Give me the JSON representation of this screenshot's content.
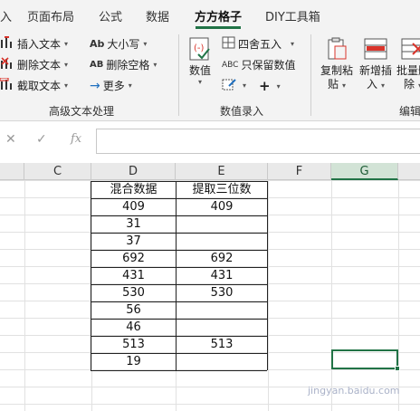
{
  "tabs": [
    {
      "label": "入"
    },
    {
      "label": "页面布局"
    },
    {
      "label": "公式"
    },
    {
      "label": "数据"
    },
    {
      "label": "方方格子"
    },
    {
      "label": "DIY工具箱"
    }
  ],
  "ribbon": {
    "text_group": {
      "insert_text": "插入文本",
      "delete_text": "删除文本",
      "cut_text": "截取文本",
      "case": "大小写",
      "delete_spaces": "删除空格",
      "more": "更多",
      "group_label": "高级文本处理"
    },
    "number_group": {
      "numeric_line1": "数值",
      "round": "四舍五入",
      "keep_numbers": "只保留数值",
      "group_label": "数值录入"
    },
    "edit_group": {
      "copy_paste_line1": "复制粘",
      "copy_paste_line2": "贴",
      "batch_insert_line1": "新增插",
      "batch_insert_line2": "入",
      "batch_delete_line1": "批量删",
      "batch_delete_line2": "除",
      "group_label": "编辑"
    }
  },
  "formula_bar": {
    "value": ""
  },
  "grid": {
    "columns": [
      "C",
      "D",
      "E",
      "F",
      "G"
    ],
    "selected_column": "G",
    "header": [
      "混合数据",
      "提取三位数"
    ],
    "rows": [
      [
        "409",
        "409"
      ],
      [
        "31",
        ""
      ],
      [
        "37",
        ""
      ],
      [
        "692",
        "692"
      ],
      [
        "431",
        "431"
      ],
      [
        "530",
        "530"
      ],
      [
        "56",
        ""
      ],
      [
        "46",
        ""
      ],
      [
        "513",
        "513"
      ],
      [
        "19",
        ""
      ]
    ]
  },
  "watermark": "jingyan.baidu.com",
  "colors": {
    "accent": "#217346",
    "ribbon_bg": "#f3f3f3",
    "header_bg": "#e9e9e9"
  }
}
